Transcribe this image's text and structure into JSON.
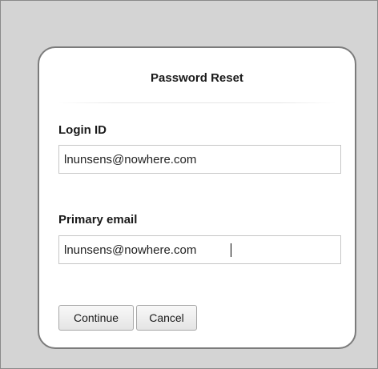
{
  "dialog": {
    "title": "Password Reset",
    "login_id": {
      "label": "Login ID",
      "value": "lnunsens@nowhere.com"
    },
    "primary_email": {
      "label": "Primary email",
      "value": "lnunsens@nowhere.com"
    },
    "buttons": {
      "continue": "Continue",
      "cancel": "Cancel"
    }
  }
}
